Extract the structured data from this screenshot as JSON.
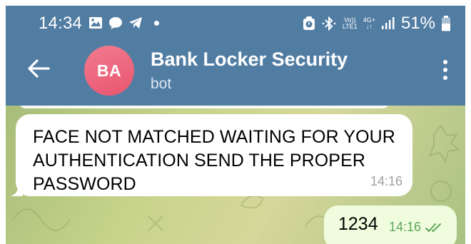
{
  "status_bar": {
    "time": "14:34",
    "volte_line1": "Vo))",
    "volte_line2": "LTE1",
    "network_line1": "4G+",
    "network_line2": "↓↑",
    "battery_percent": "51%",
    "left_icons": [
      "image-icon",
      "chat-bubble-icon",
      "telegram-send-icon",
      "dot-icon"
    ],
    "right_icons": [
      "alarm-lock-icon",
      "bluetooth-icon",
      "volte-icon",
      "4g-icon",
      "signal-icon",
      "battery-icon"
    ]
  },
  "header": {
    "avatar_initials": "BA",
    "title": "Bank Locker Security",
    "subtitle": "bot",
    "background_color": "#527da3",
    "avatar_color": "#e8566f"
  },
  "messages": [
    {
      "direction": "incoming",
      "text": "FACE NOT MATCHED WAITING FOR YOUR AUTHENTICATION SEND THE PROPER PASSWORD",
      "time": "14:16"
    },
    {
      "direction": "outgoing",
      "text": "1234",
      "time": "14:16",
      "status": "read-double-check"
    }
  ]
}
